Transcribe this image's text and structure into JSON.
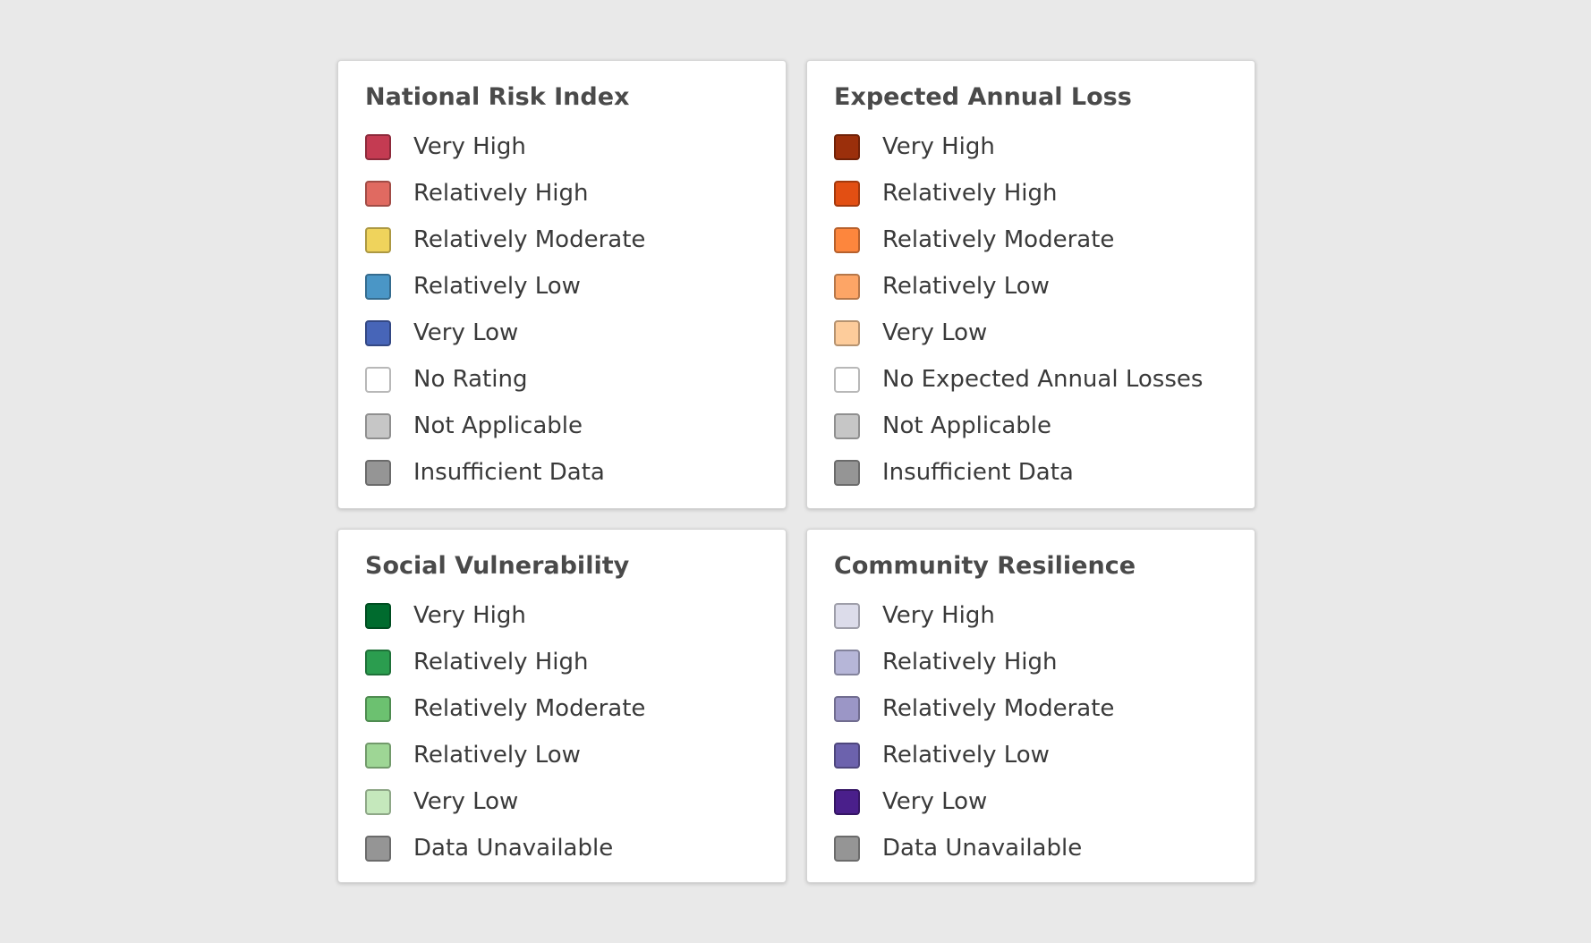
{
  "panels": [
    {
      "title": "National Risk Index",
      "items": [
        {
          "label": "Very High",
          "color": "#c43b52"
        },
        {
          "label": "Relatively High",
          "color": "#e06a61"
        },
        {
          "label": "Relatively Moderate",
          "color": "#efd35c"
        },
        {
          "label": "Relatively Low",
          "color": "#4a96c6"
        },
        {
          "label": "Very Low",
          "color": "#4765b8"
        },
        {
          "label": "No Rating",
          "color": "#ffffff"
        },
        {
          "label": "Not Applicable",
          "color": "#c6c6c6"
        },
        {
          "label": "Insufficient Data",
          "color": "#959595"
        }
      ]
    },
    {
      "title": "Expected Annual Loss",
      "items": [
        {
          "label": "Very High",
          "color": "#9b2f0b"
        },
        {
          "label": "Relatively High",
          "color": "#e24f13"
        },
        {
          "label": "Relatively Moderate",
          "color": "#fd863d"
        },
        {
          "label": "Relatively Low",
          "color": "#fda566"
        },
        {
          "label": "Very Low",
          "color": "#fdcc9b"
        },
        {
          "label": "No Expected Annual Losses",
          "color": "#ffffff"
        },
        {
          "label": "Not Applicable",
          "color": "#c6c6c6"
        },
        {
          "label": "Insufficient Data",
          "color": "#959595"
        }
      ]
    },
    {
      "title": "Social Vulnerability",
      "items": [
        {
          "label": "Very High",
          "color": "#006b2e"
        },
        {
          "label": "Relatively High",
          "color": "#2b9d4f"
        },
        {
          "label": "Relatively Moderate",
          "color": "#6cc170"
        },
        {
          "label": "Relatively Low",
          "color": "#9ed695"
        },
        {
          "label": "Very Low",
          "color": "#c5e8bc"
        },
        {
          "label": "Data Unavailable",
          "color": "#959595"
        }
      ]
    },
    {
      "title": "Community Resilience",
      "items": [
        {
          "label": "Very High",
          "color": "#dcdcea"
        },
        {
          "label": "Relatively High",
          "color": "#b6b6d8"
        },
        {
          "label": "Relatively Moderate",
          "color": "#9b96c6"
        },
        {
          "label": "Relatively Low",
          "color": "#6c62ad"
        },
        {
          "label": "Very Low",
          "color": "#4a1f8b"
        },
        {
          "label": "Data Unavailable",
          "color": "#959595"
        }
      ]
    }
  ]
}
